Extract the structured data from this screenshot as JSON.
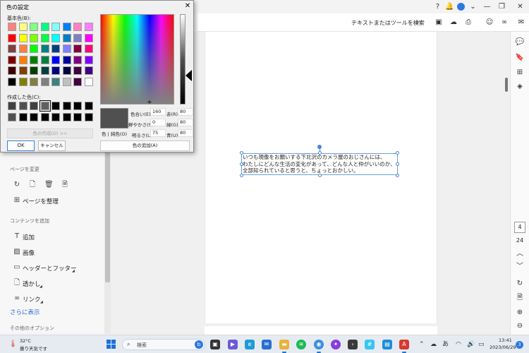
{
  "dialog": {
    "title": "色の設定",
    "basic_colors_label": "基本色(B):",
    "custom_colors_label": "作成した色(C):",
    "define_custom_label": "色の作成(D) >>",
    "ok_label": "OK",
    "cancel_label": "キャンセル",
    "add_to_custom_label": "色の追加(A)",
    "preview_label": "色 | 純色(O)",
    "hue_label": "色合い(E):",
    "hue_value": "160",
    "sat_label": "鮮やかさ(S):",
    "sat_value": "0",
    "lum_label": "明るさ(L):",
    "lum_value": "75",
    "red_label": "赤(R):",
    "red_value": "80",
    "green_label": "緑(G):",
    "green_value": "80",
    "blue_label": "青(U):",
    "blue_value": "80",
    "current_color": "#505050",
    "basic_colors": [
      "#ff8080",
      "#ffff80",
      "#80ff80",
      "#00ff80",
      "#80ffff",
      "#0080ff",
      "#ff80c0",
      "#ff80ff",
      "#ff0000",
      "#ffff00",
      "#80ff00",
      "#00ff40",
      "#00ffff",
      "#0080c0",
      "#8080c0",
      "#ff00ff",
      "#804040",
      "#ff8040",
      "#00ff00",
      "#008080",
      "#004080",
      "#8080ff",
      "#800040",
      "#ff0080",
      "#800000",
      "#ff8000",
      "#008000",
      "#008040",
      "#0000ff",
      "#0000a0",
      "#800080",
      "#8000ff",
      "#400000",
      "#804000",
      "#004000",
      "#004040",
      "#000080",
      "#000040",
      "#400040",
      "#400080",
      "#000000",
      "#808000",
      "#808040",
      "#808080",
      "#408080",
      "#c0c0c0",
      "#400040",
      "#ffffff"
    ],
    "custom_colors": [
      "#404040",
      "#505050",
      "#404040",
      "#606060",
      "#000000",
      "#000000",
      "#000000",
      "#000000",
      "#505050",
      "#000000",
      "#000000",
      "#000000",
      "#000000",
      "#000000",
      "#000000",
      "#000000"
    ]
  },
  "app": {
    "search_tools_placeholder": "テキストまたはツールを検索",
    "left_panel": {
      "section_pages": "ページを変更",
      "organize_pages": "ページを整理",
      "section_content": "コンテンツを追加",
      "add_text": "追加",
      "image": "画像",
      "header_footer": "ヘッダーとフッター",
      "watermark": "透かし",
      "link": "リンク",
      "show_more": "さらに表示",
      "section_other": "その他のオプション"
    },
    "document_text": [
      "いつも現像をお願いする下北沢のカメラ屋のおじさんには、",
      "わたしにどんな生活の変化があって、どんな人と仲がいいのか、",
      "全部知られていると思うと、ちょっとおかしい。"
    ],
    "current_page": "4",
    "total_pages": "24"
  },
  "taskbar": {
    "temperature": "32°C",
    "weather": "曇り天気です",
    "search_placeholder": "検索",
    "search_badge": "b",
    "ime": "あ",
    "time": "13:41",
    "date": "2023/06/29",
    "notification_count": "3"
  }
}
